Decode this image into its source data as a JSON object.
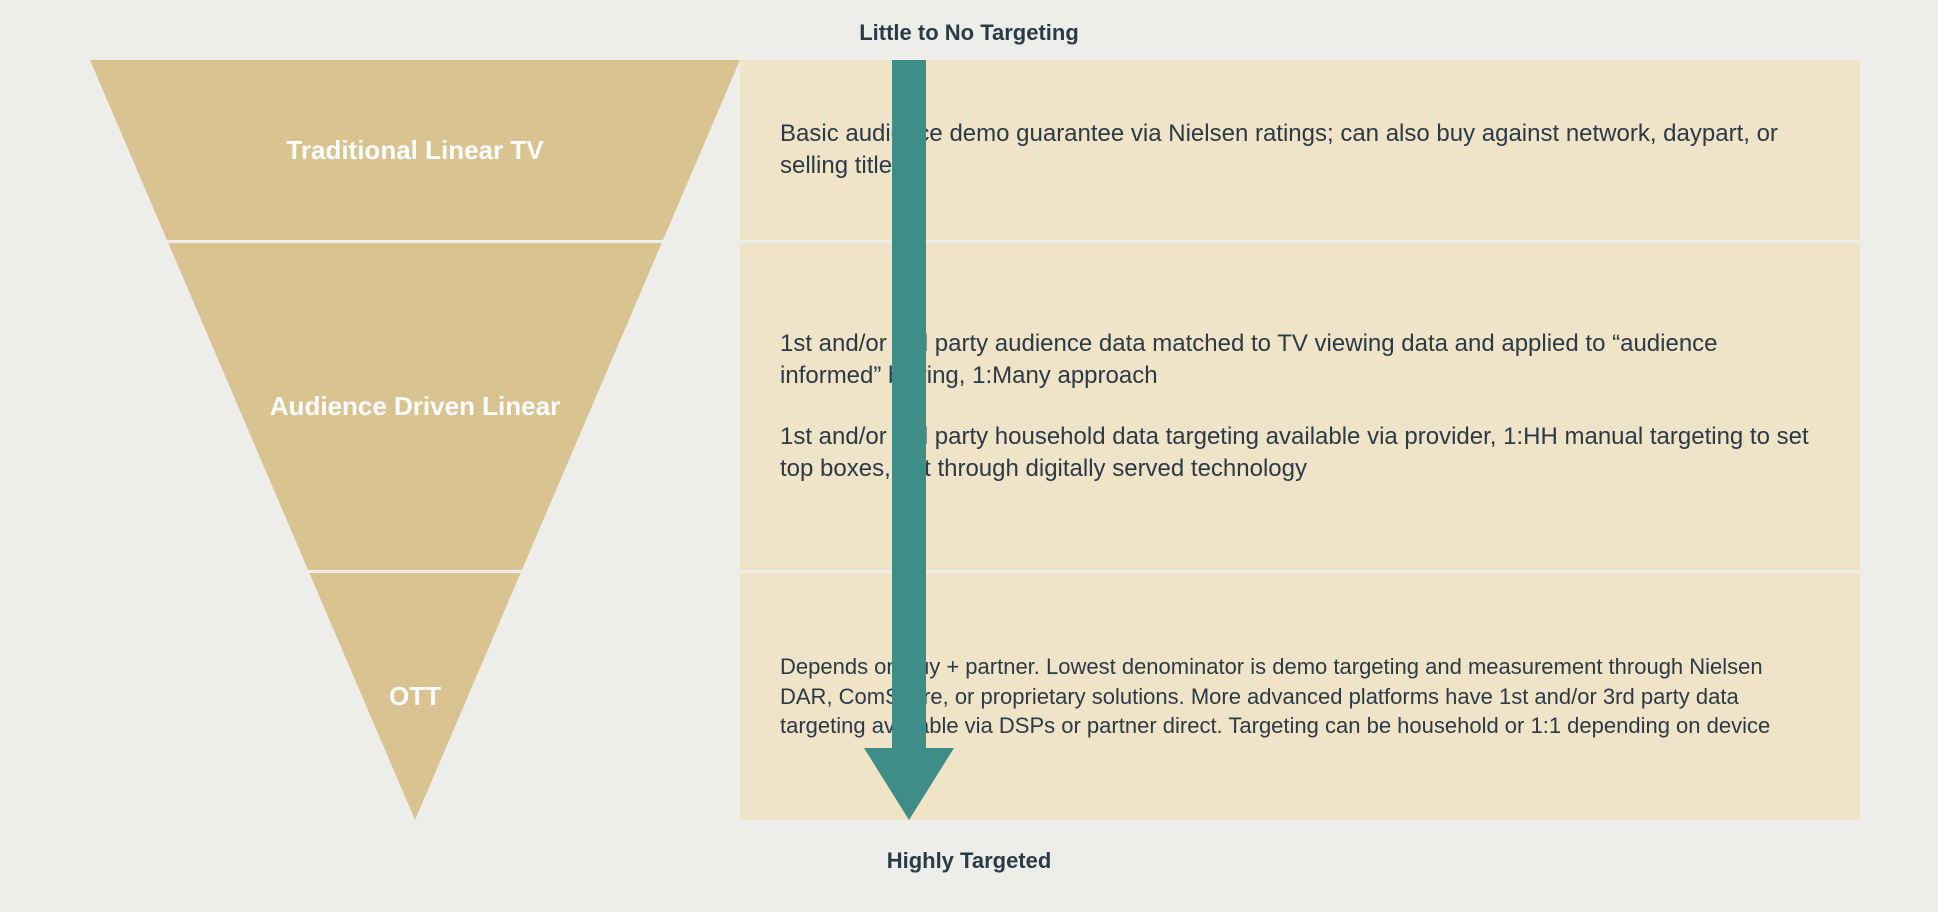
{
  "labels": {
    "top": "Little to No Targeting",
    "bottom": "Highly Targeted"
  },
  "rows": [
    {
      "title": "Traditional Linear TV",
      "paragraphs": [
        "Basic audience demo guarantee via Nielsen ratings; can also buy against network, daypart, or selling title"
      ]
    },
    {
      "title": "Audience Driven Linear",
      "paragraphs": [
        "1st and/or 3rd party audience data matched to TV viewing data and applied to “audience informed” buying, 1:Many approach",
        "1st and/or 3rd party household data targeting available via provider, 1:HH manual targeting to set top boxes, not through digitally served technology"
      ]
    },
    {
      "title": "OTT",
      "paragraphs": [
        "Depends on buy + partner. Lowest denominator is demo targeting and measurement through Nielsen DAR, ComScore, or proprietary solutions. More advanced platforms have 1st and/or 3rd party data targeting available via DSPs or partner direct. Targeting can be household or 1:1 depending on device"
      ]
    }
  ],
  "colors": {
    "funnel": "#d9c391",
    "panel": "#efe3c8",
    "arrow": "#3f8d87",
    "text": "#2b3a45",
    "bg": "#ededea"
  }
}
